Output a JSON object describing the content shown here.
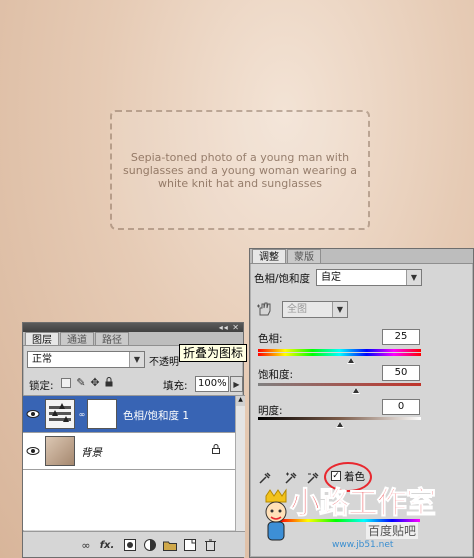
{
  "photo": {
    "placeholder": "Sepia-toned photo of a young man with sunglasses and a young woman wearing a white knit hat and sunglasses"
  },
  "adjustments": {
    "tabs": [
      "调整",
      "蒙版"
    ],
    "active_tab": 0,
    "preset_label": "色相/饱和度",
    "preset_value": "自定",
    "channel_value": "全图",
    "hue": {
      "label": "色相:",
      "value": "25",
      "position": 0.57
    },
    "saturation": {
      "label": "饱和度:",
      "value": "50",
      "position": 0.6
    },
    "lightness": {
      "label": "明度:",
      "value": "0",
      "position": 0.5
    },
    "colorize_label": "着色",
    "colorize_checked": true,
    "highlight_color": "#e8282f"
  },
  "layers": {
    "tabs": [
      "图层",
      "通道",
      "路径"
    ],
    "active_tab": 0,
    "blend_mode": "正常",
    "opacity_label": "不透明",
    "lock_label": "锁定:",
    "fill_label": "填充:",
    "fill_value": "100%",
    "tooltip": "折叠为图标",
    "items": [
      {
        "name": "色相/饱和度 1",
        "selected": true
      },
      {
        "name": "背景",
        "selected": false,
        "italic": true
      }
    ],
    "selected_color": "#3864b4"
  },
  "bottom_icons": [
    "link-icon",
    "fx-icon",
    "mask-icon",
    "adjustment-icon",
    "folder-icon",
    "new-layer-icon",
    "trash-icon"
  ],
  "watermark": {
    "main": "小路工作室",
    "sub": "百度贴吧",
    "site": "www.jb51.net"
  }
}
